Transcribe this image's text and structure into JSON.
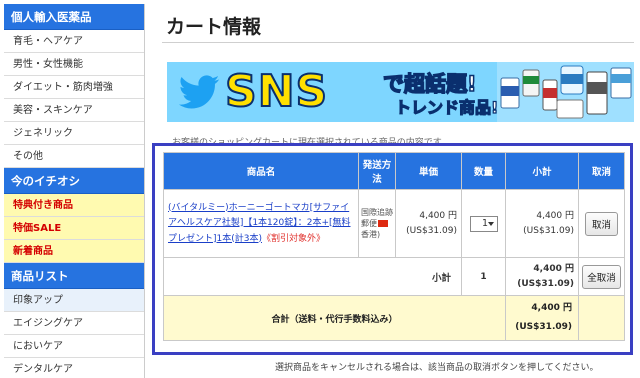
{
  "sidebar": {
    "sections": [
      {
        "header": "個人輸入医薬品",
        "items": [
          {
            "label": "育毛・ヘアケア",
            "style": "normal"
          },
          {
            "label": "男性・女性機能",
            "style": "normal"
          },
          {
            "label": "ダイエット・筋肉増強",
            "style": "normal"
          },
          {
            "label": "美容・スキンケア",
            "style": "normal"
          },
          {
            "label": "ジェネリック",
            "style": "normal"
          },
          {
            "label": "その他",
            "style": "normal"
          }
        ]
      },
      {
        "header": "今のイチオシ",
        "items": [
          {
            "label": "特典付き商品",
            "style": "hl"
          },
          {
            "label": "特価SALE",
            "style": "hl"
          },
          {
            "label": "新着商品",
            "style": "hl"
          }
        ]
      },
      {
        "header": "商品リスト",
        "items": [
          {
            "label": "印象アップ",
            "style": "sel"
          },
          {
            "label": "エイジングケア",
            "style": "normal"
          },
          {
            "label": "においケア",
            "style": "normal"
          },
          {
            "label": "デンタルケア",
            "style": "normal"
          }
        ]
      }
    ]
  },
  "main": {
    "title": "カート情報",
    "banner": {
      "big": "SNS",
      "line1": "で超話題!",
      "line2": "トレンド商品!",
      "bg_color": "#7ed6ff"
    },
    "notice": "お客様のショッピングカートに現在選択されている商品の内容です。",
    "footer_note": "選択商品をキャンセルされる場合は、該当商品の取消ボタンを押してください。"
  },
  "cart": {
    "headers": {
      "product": "商品名",
      "shipping": "発送方法",
      "price": "単価",
      "qty": "数量",
      "subtotal": "小計",
      "cancel": "取消"
    },
    "items": [
      {
        "name": "(バイタルミー)ホーニーゴートマカ[サファイアヘルスケア社製]【1本120錠】：2本+[無料プレゼント]1本(計3本)",
        "note": "《割引対象外》",
        "shipping_a": "国際追跡",
        "shipping_b": "郵便",
        "shipping_c": "香港)",
        "price": "4,400 円",
        "price_usd": "(US$31.09)",
        "qty": "1",
        "subtotal": "4,400 円",
        "subtotal_usd": "(US$31.09)",
        "cancel_label": "取消"
      }
    ],
    "subtotal_row": {
      "label": "小計",
      "qty": "1",
      "amount": "4,400 円",
      "amount_usd": "(US$31.09)",
      "cancel_all_label": "全取消"
    },
    "total_row": {
      "label": "合計（送料・代行手数料込み）",
      "amount": "4,400 円",
      "amount_usd": "(US$31.09)"
    }
  },
  "colors": {
    "accent": "#2673e0",
    "frame": "#3a3fc2",
    "highlight_bg": "#fffab0",
    "total_bg": "#fffacf",
    "link": "#1a3fc8",
    "alert": "#e0302c"
  }
}
